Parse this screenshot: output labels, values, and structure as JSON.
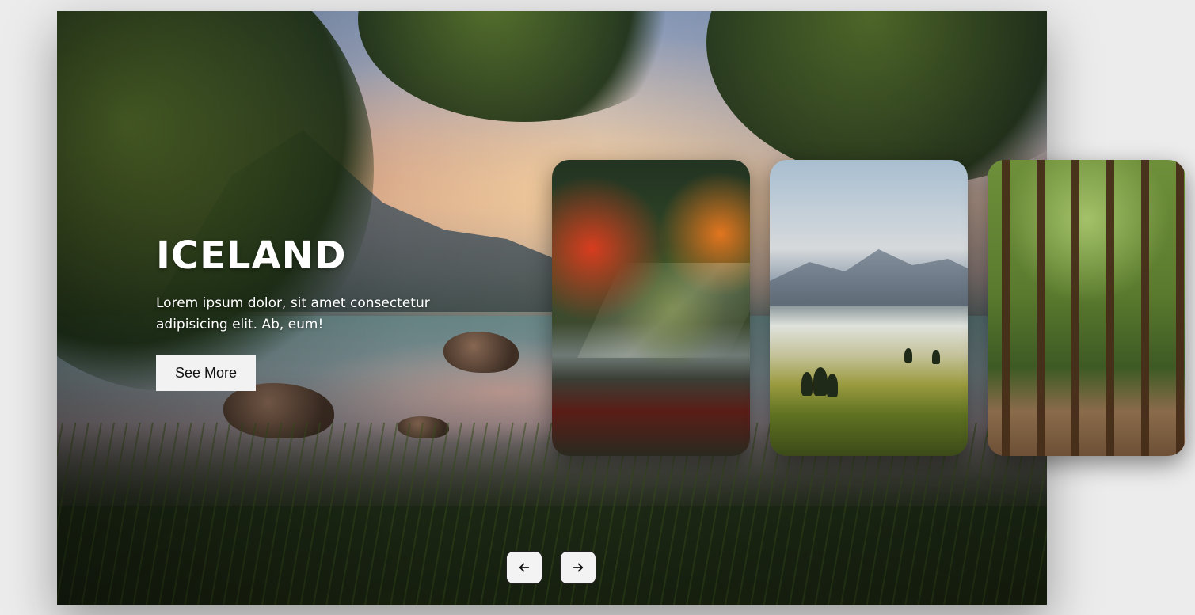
{
  "hero": {
    "title": "ICELAND",
    "description": "Lorem ipsum dolor, sit amet consectetur adipisicing elit. Ab, eum!",
    "button_label": "See More"
  },
  "cards": [
    {
      "icon": "autumn-lake-image"
    },
    {
      "icon": "misty-valley-image"
    },
    {
      "icon": "forest-path-image"
    }
  ],
  "navigation": {
    "prev_icon": "arrow-left-icon",
    "next_icon": "arrow-right-icon"
  },
  "colors": {
    "button_background": "#f2f2f2",
    "title_text": "#ffffff",
    "page_background": "#ececec"
  }
}
